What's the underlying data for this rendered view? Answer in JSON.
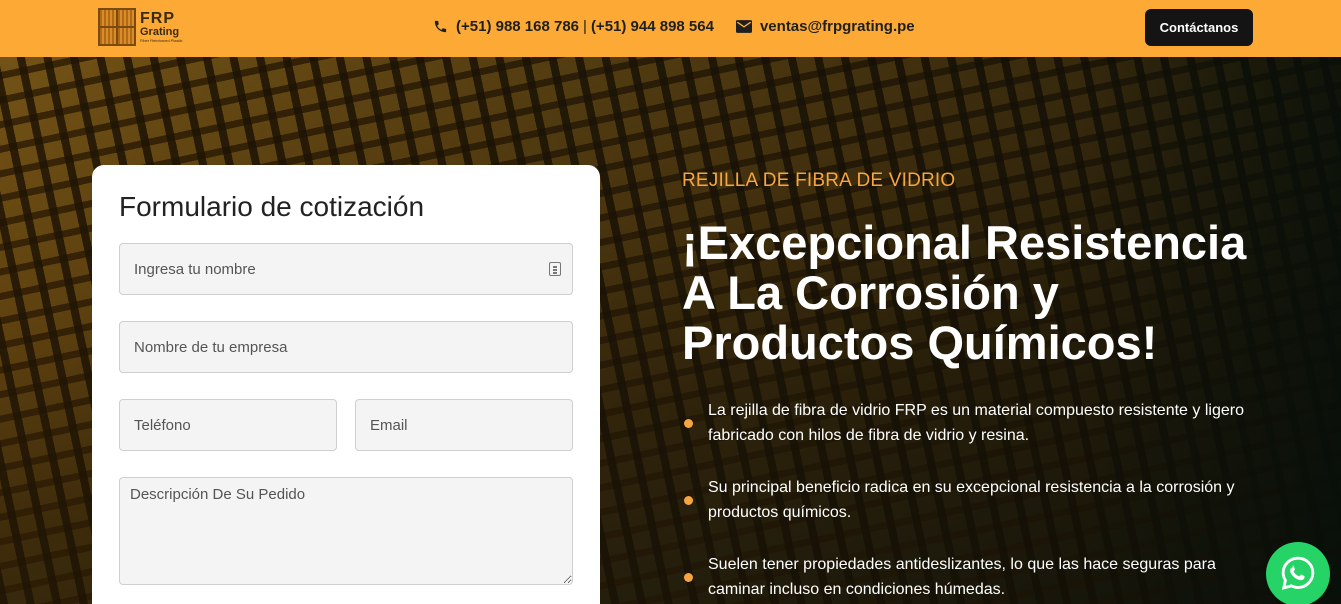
{
  "header": {
    "logo": {
      "name": "FRP",
      "sub": "Grating",
      "tagline": "Fiber Reinforced Plastic"
    },
    "phone_numbers": [
      "(+51) 988 168 786",
      "(+51) 944 898 564"
    ],
    "phone_separator": "|",
    "email": "ventas@frpgrating.pe",
    "cta_label": "Contáctanos",
    "background_color": "#fcaa35"
  },
  "form": {
    "title": "Formulario de cotización",
    "name_placeholder": "Ingresa tu nombre",
    "company_placeholder": "Nombre de tu empresa",
    "phone_placeholder": "Teléfono",
    "email_placeholder": "Email",
    "description_placeholder": "Descripción De Su Pedido"
  },
  "hero": {
    "eyebrow": "REJILLA DE FIBRA DE VIDRIO",
    "headline": "¡Excepcional Resistencia A La Corrosión y Productos Químicos!",
    "bullets": [
      "La rejilla de fibra de vidrio FRP es un material compuesto resistente y ligero fabricado con hilos de fibra de vidrio y resina.",
      "Su principal beneficio radica en su excepcional resistencia a la corrosión y productos químicos.",
      "Suelen tener propiedades antideslizantes, lo que las hace seguras para caminar incluso en condiciones húmedas."
    ],
    "accent_color": "#f7a541"
  },
  "icons": {
    "phone": "phone-icon",
    "email": "envelope-icon",
    "contact_card": "contact-card-icon",
    "whatsapp": "whatsapp-icon"
  }
}
